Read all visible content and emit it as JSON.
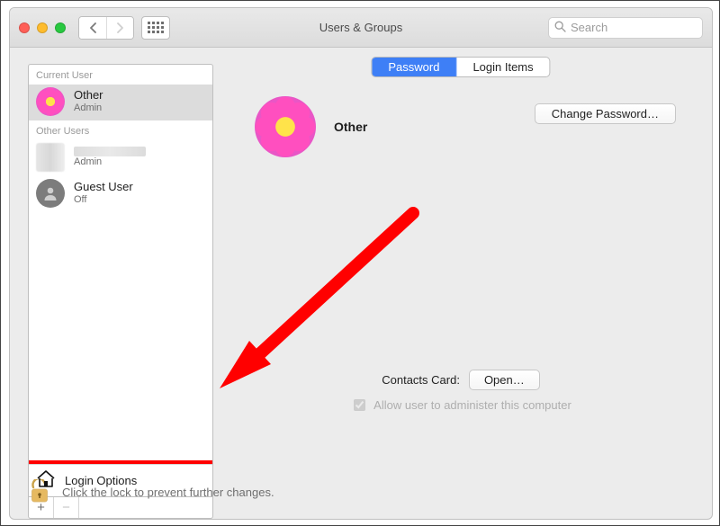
{
  "window": {
    "title": "Users & Groups"
  },
  "search": {
    "placeholder": "Search"
  },
  "sidebar": {
    "section_current": "Current User",
    "section_other": "Other Users",
    "users": {
      "current": {
        "name": "Other",
        "role": "Admin"
      },
      "hidden": {
        "role": "Admin"
      },
      "guest": {
        "name": "Guest User",
        "role": "Off"
      }
    },
    "login_options": "Login Options"
  },
  "tabs": {
    "password": "Password",
    "login_items": "Login Items"
  },
  "main": {
    "username": "Other",
    "change_password": "Change Password…",
    "contacts_label": "Contacts Card:",
    "open": "Open…",
    "admin_checkbox": "Allow user to administer this computer"
  },
  "lock": {
    "text": "Click the lock to prevent further changes."
  }
}
